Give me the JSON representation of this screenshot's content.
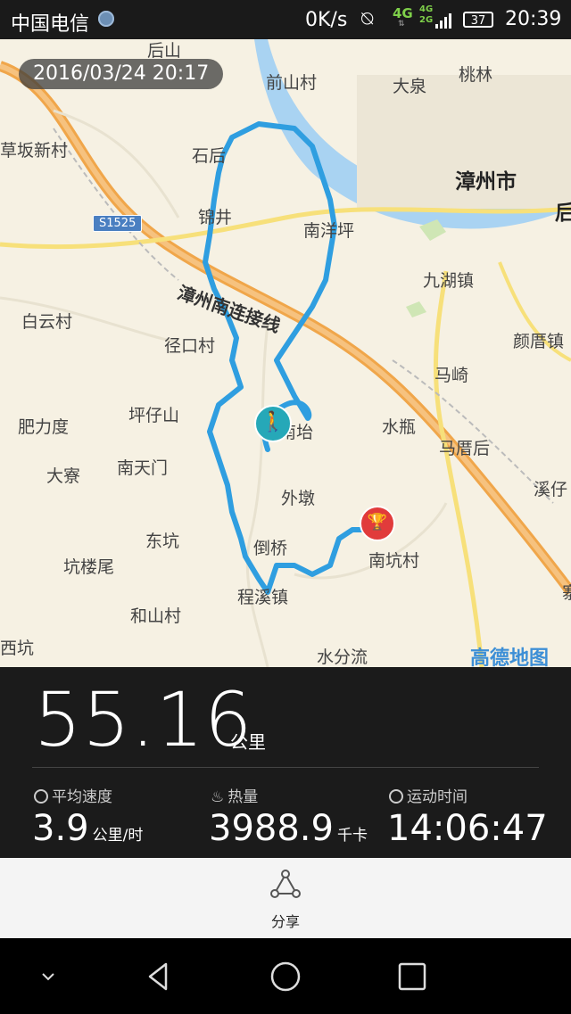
{
  "status_bar": {
    "carrier": "中国电信",
    "net_speed": "0K/s",
    "network_1": "4G",
    "network_2_top": "4G",
    "network_2_bottom": "2G",
    "battery": "37",
    "time": "20:39"
  },
  "map": {
    "date_time": "2016/03/24 20:17",
    "road_shield": "S1525",
    "road_name": "漳州南连接线",
    "logo": "高德地图",
    "route_color": "#2f9ee0",
    "start_icon": "walker-icon",
    "end_icon": "trophy-icon",
    "labels": [
      "后山",
      "前山村",
      "大泉",
      "桃林",
      "草坂新村",
      "石后",
      "漳州市",
      "后",
      "锦井",
      "南洋坪",
      "九湖镇",
      "白云村",
      "径口村",
      "颜厝镇",
      "马崎",
      "肥力度",
      "坪仔山",
      "南坮",
      "水瓶",
      "马厝后",
      "大寮",
      "南天门",
      "外墩",
      "溪仔",
      "东坑",
      "倒桥",
      "南坑村",
      "坑楼尾",
      "程溪镇",
      "和山村",
      "寨",
      "西坑",
      "水分流"
    ]
  },
  "stats": {
    "distance": "55.16",
    "distance_unit": "公里",
    "avg_speed_label": "平均速度",
    "avg_speed_value": "3.9",
    "avg_speed_unit": "公里/时",
    "calories_label": "热量",
    "calories_value": "3988.9",
    "calories_unit": "千卡",
    "duration_label": "运动时间",
    "duration_value": "14:06:47"
  },
  "share": {
    "label": "分享"
  }
}
